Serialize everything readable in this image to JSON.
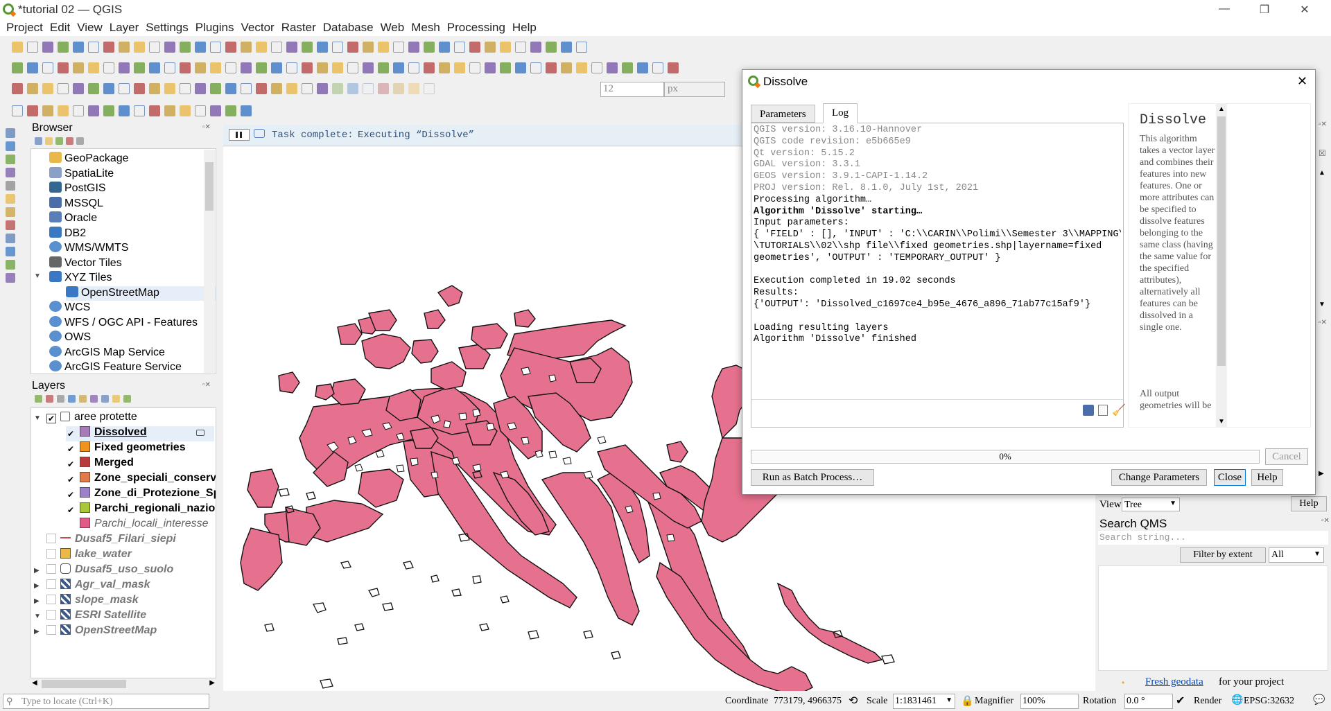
{
  "window": {
    "title": "*tutorial 02 — QGIS"
  },
  "menu": [
    "Project",
    "Edit",
    "View",
    "Layer",
    "Settings",
    "Plugins",
    "Vector",
    "Raster",
    "Database",
    "Web",
    "Mesh",
    "Processing",
    "Help"
  ],
  "toolbar": {
    "font_size_value": "12",
    "unit": "px"
  },
  "browser": {
    "title": "Browser",
    "items": [
      {
        "label": "GeoPackage",
        "icon": "geopackage-icon",
        "color": "#e8b84a"
      },
      {
        "label": "SpatiaLite",
        "icon": "spatialite-icon",
        "color": "#8aa0c8"
      },
      {
        "label": "PostGIS",
        "icon": "postgis-icon",
        "color": "#336791"
      },
      {
        "label": "MSSQL",
        "icon": "mssql-icon",
        "color": "#4a6ea8"
      },
      {
        "label": "Oracle",
        "icon": "oracle-icon",
        "color": "#5a7fb8"
      },
      {
        "label": "DB2",
        "icon": "db2-icon",
        "color": "#3b78c4"
      },
      {
        "label": "WMS/WMTS",
        "icon": "globe-icon",
        "color": "#5a8fd0"
      },
      {
        "label": "Vector Tiles",
        "icon": "grid-icon",
        "color": "#666"
      },
      {
        "label": "XYZ Tiles",
        "icon": "grid-icon",
        "color": "#3b78c4"
      },
      {
        "label": "OpenStreetMap",
        "icon": "grid-icon",
        "color": "#3b78c4"
      },
      {
        "label": "WCS",
        "icon": "globe-icon",
        "color": "#5a8fd0"
      },
      {
        "label": "WFS / OGC API - Features",
        "icon": "globe-icon",
        "color": "#5a8fd0"
      },
      {
        "label": "OWS",
        "icon": "globe-icon",
        "color": "#5a8fd0"
      },
      {
        "label": "ArcGIS Map Service",
        "icon": "globe-icon",
        "color": "#5a8fd0"
      },
      {
        "label": "ArcGIS Feature Service",
        "icon": "globe-icon",
        "color": "#5a8fd0"
      }
    ]
  },
  "layers": {
    "title": "Layers",
    "group": "aree protette",
    "items": [
      {
        "label": "Dissolved",
        "color": "#a77bb8",
        "checked": true,
        "bold": true
      },
      {
        "label": "Fixed geometries",
        "color": "#f0921e",
        "checked": true,
        "bold": true
      },
      {
        "label": "Merged",
        "color": "#b83a3a",
        "checked": true,
        "bold": true
      },
      {
        "label": "Zone_speciali_conserv",
        "color": "#e07a4a",
        "checked": true,
        "bold": true
      },
      {
        "label": "Zone_di_Protezione_Sp",
        "color": "#9b82c8",
        "checked": true,
        "bold": true
      },
      {
        "label": "Parchi_regionali_nazio",
        "color": "#a8c83a",
        "checked": true,
        "bold": true
      },
      {
        "label": "Parchi_locali_interesse",
        "color": "#e05a8a",
        "checked": false,
        "bold": false
      }
    ],
    "others": [
      {
        "label": "Dusaf5_Filari_siepi",
        "type": "line",
        "color": "#c84a4a"
      },
      {
        "label": "lake_water",
        "type": "fill",
        "color": "#e8b84a"
      },
      {
        "label": "Dusaf5_uso_suolo",
        "type": "poly",
        "color": "#aaa"
      },
      {
        "label": "Agr_val_mask",
        "type": "raster",
        "color": "#3b5a8a"
      },
      {
        "label": "slope_mask",
        "type": "raster",
        "color": "#3b5a8a"
      },
      {
        "label": "ESRI Satellite",
        "type": "raster",
        "color": "#3b5a8a"
      },
      {
        "label": "OpenStreetMap",
        "type": "raster",
        "color": "#3b5a8a"
      }
    ]
  },
  "task": {
    "prefix": "Task complete:",
    "text": "Executing “Dissolve”"
  },
  "dialog": {
    "title": "Dissolve",
    "tabs": [
      "Parameters",
      "Log"
    ],
    "active_tab": "Log",
    "log_grey": [
      "QGIS version: 3.16.10-Hannover",
      "QGIS code revision: e5b665e9",
      "Qt version: 5.15.2",
      "GDAL version: 3.3.1",
      "GEOS version: 3.9.1-CAPI-1.14.2",
      "PROJ version: Rel. 8.1.0, July 1st, 2021"
    ],
    "log_main": [
      "Processing algorithm…",
      "Algorithm 'Dissolve' starting…",
      "Input parameters:",
      "{ 'FIELD' : [], 'INPUT' : 'C:\\\\CARIN\\\\Polimi\\\\Semester 3\\\\MAPPING\\",
      "\\TUTORIALS\\\\02\\\\shp file\\\\fixed geometries.shp|layername=fixed",
      "geometries', 'OUTPUT' : 'TEMPORARY_OUTPUT' }",
      "",
      "Execution completed in 19.02 seconds",
      "Results:",
      "{'OUTPUT': 'Dissolved_c1697ce4_b95e_4676_a896_71ab77c15af9'}",
      "",
      "Loading resulting layers",
      "Algorithm 'Dissolve' finished"
    ],
    "bold_lines": [
      1
    ],
    "help_title": "Dissolve",
    "help_text": "This algorithm takes a vector layer and combines their features into new features. One or more attributes can be specified to dissolve features belonging to the same class (having the same value for the specified attributes), alternatively all features can be dissolved in a single one.",
    "help_text2": "All output geometries will be",
    "progress": "0%",
    "progress_value": 0,
    "cancel": "Cancel",
    "batch": "Run as Batch Process…",
    "change": "Change Parameters",
    "close": "Close",
    "help": "Help"
  },
  "right_panel": {
    "view_label": "View",
    "view_value": "Tree",
    "help_btn": "Help",
    "qms_title": "Search QMS",
    "qms_placeholder": "Search string...",
    "filter_btn": "Filter by extent",
    "filter_value": "All",
    "fresh_link": "Fresh geodata",
    "fresh_text": "for your project"
  },
  "status": {
    "locate_placeholder": "Type to locate (Ctrl+K)",
    "coordinate_label": "Coordinate",
    "coordinate": "773179, 4966375",
    "scale_label": "Scale",
    "scale": "1:1831461",
    "magnifier_label": "Magnifier",
    "magnifier": "100%",
    "rotation_label": "Rotation",
    "rotation": "0.0 °",
    "render_label": "Render",
    "crs": "EPSG:32632"
  },
  "colors": {
    "polygon_fill": "#e5718e",
    "polygon_stroke": "#111111",
    "accent": "#589632"
  }
}
